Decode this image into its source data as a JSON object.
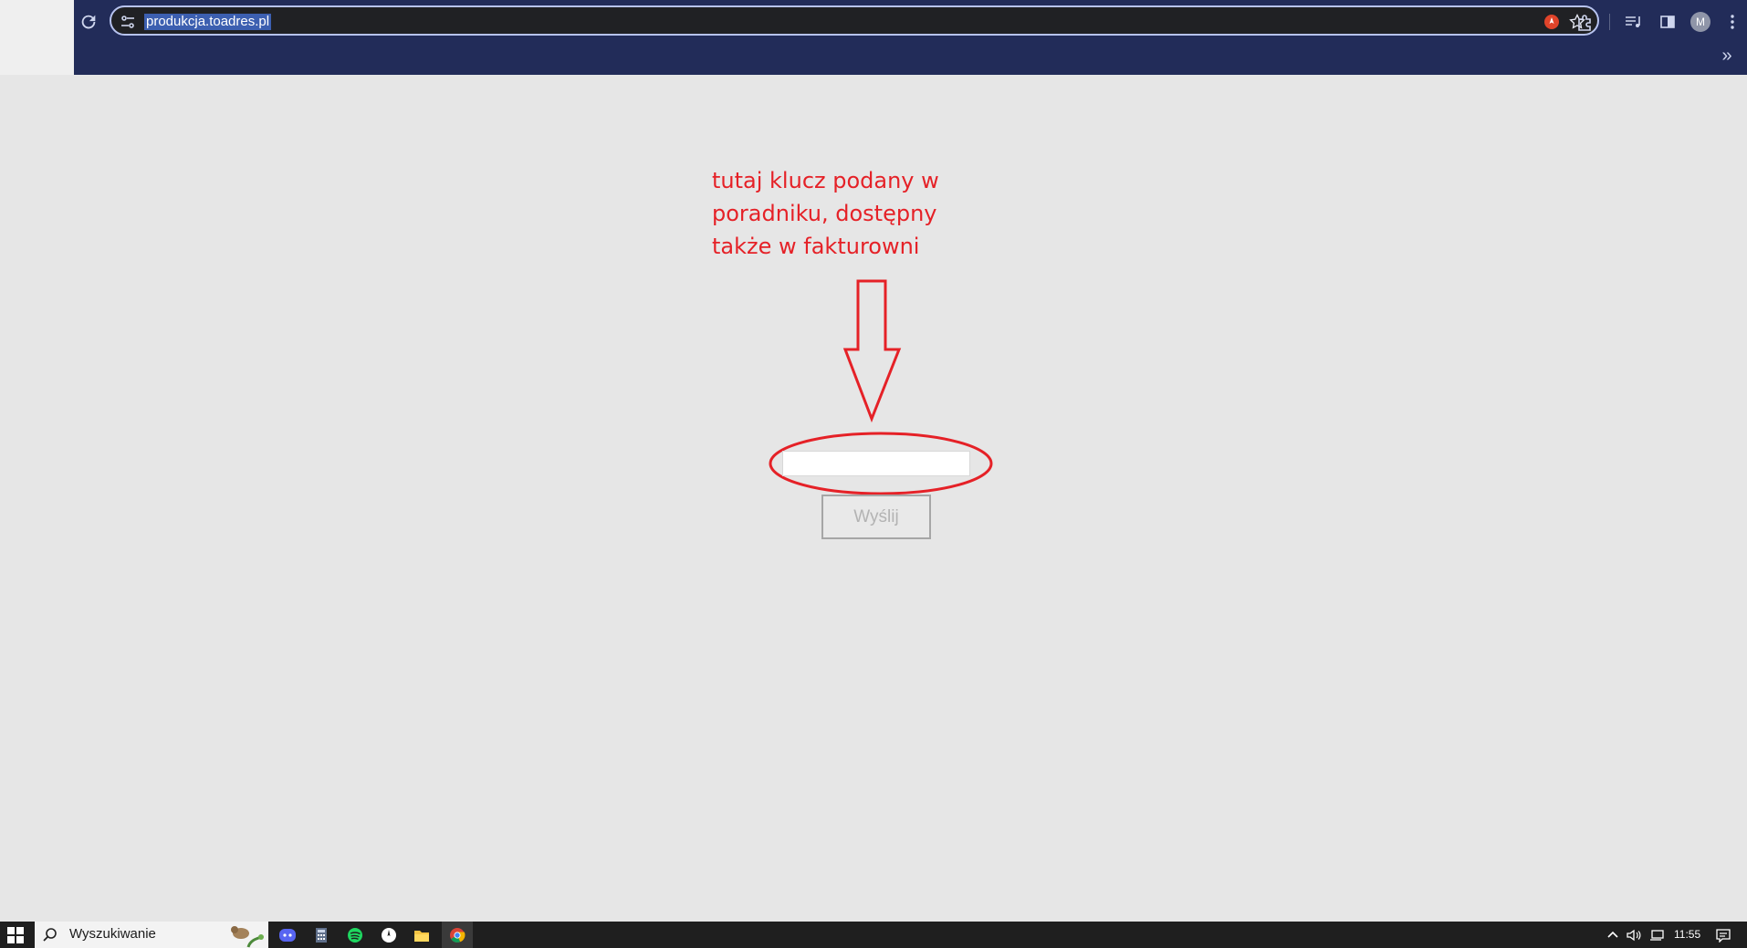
{
  "browser": {
    "url": "produkcja.toadres.pl",
    "profile_initial": "M",
    "bookmarks_overflow": "»"
  },
  "annotation": {
    "lines": [
      "tutaj klucz podany w",
      "poradniku, dostępny",
      "także w fakturowni"
    ],
    "color": "#e52127"
  },
  "form": {
    "key_value": "",
    "submit_label": "Wyślij"
  },
  "taskbar": {
    "search_placeholder": "Wyszukiwanie",
    "apps": [
      "discord-icon",
      "calculator-icon",
      "spotify-icon",
      "app-icon",
      "file-explorer-icon",
      "chrome-icon"
    ],
    "time": "11:55"
  }
}
